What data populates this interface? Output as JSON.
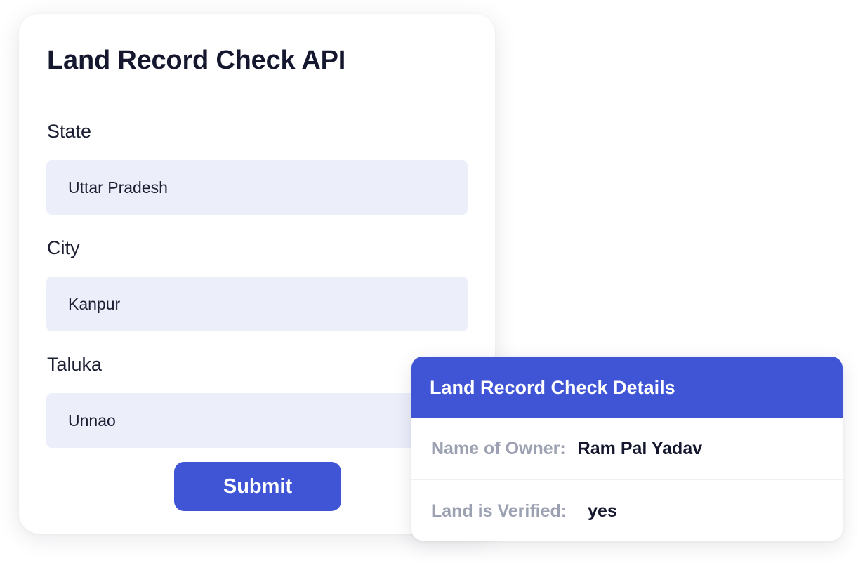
{
  "form": {
    "title": "Land Record Check API",
    "fields": [
      {
        "label": "State",
        "value": "Uttar Pradesh"
      },
      {
        "label": "City",
        "value": "Kanpur"
      },
      {
        "label": "Taluka",
        "value": "Unnao"
      }
    ],
    "submit_label": "Submit"
  },
  "result": {
    "title": "Land Record Check Details",
    "rows": [
      {
        "key": "Name of Owner:",
        "value": "Ram Pal Yadav"
      },
      {
        "key": "Land is Verified:",
        "value": "yes"
      }
    ]
  },
  "colors": {
    "accent": "#3f55d6",
    "input_background": "#eceefa",
    "heading_text": "#14172e",
    "muted_label": "#9ca1b2",
    "page_background": "#ffffff"
  }
}
